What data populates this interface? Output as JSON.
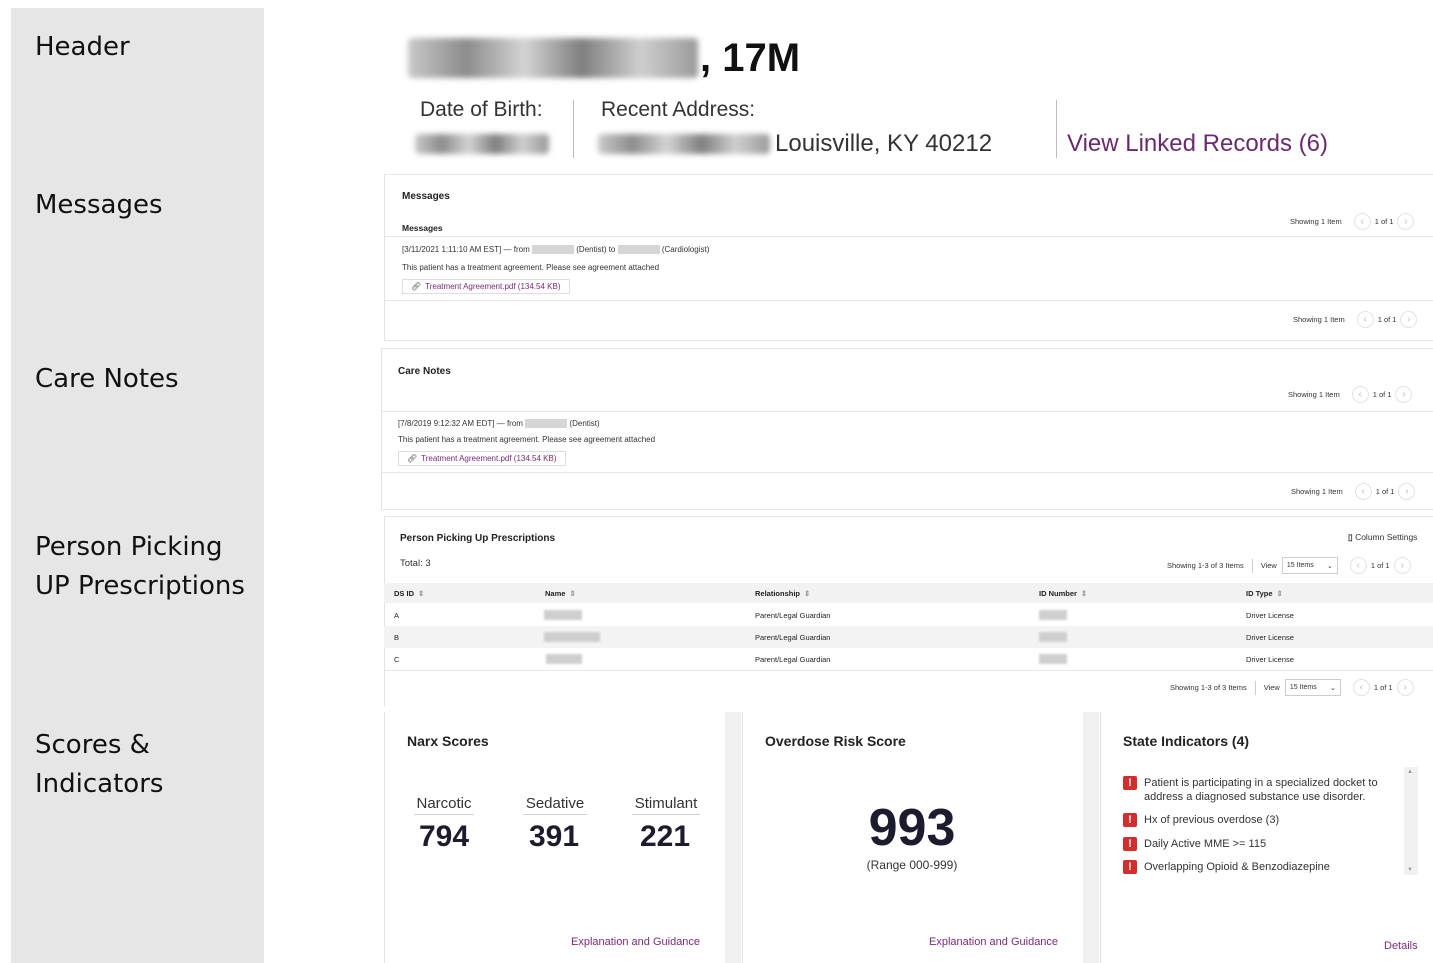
{
  "sidebar": {
    "labels": [
      "Header",
      "Messages",
      "Care Notes",
      "Person Picking\nUP Prescriptions",
      "Scores &\nIndicators"
    ]
  },
  "header": {
    "age_sex": ", 17M",
    "dob_label": "Date of Birth:",
    "address_label": "Recent Address:",
    "address_city": "Louisville, KY 40212",
    "linked_records": "View Linked Records (6)"
  },
  "messages": {
    "panel_title": "Messages",
    "section_title": "Messages",
    "pager_top": {
      "showing": "Showing 1 Item",
      "page": "1 of 1"
    },
    "pager_bottom": {
      "showing": "Showing 1 Item",
      "page": "1 of 1"
    },
    "meta_prefix": "[3/11/2021 1:11:10 AM EST] — from",
    "from_role": "(Dentist) to",
    "to_role": "(Cardiologist)",
    "body": "This patient has a treatment agreement. Please see agreement attached",
    "attachment": "Treatment Agreement.pdf (134.54 KB)"
  },
  "care_notes": {
    "title": "Care Notes",
    "pager_top": {
      "showing": "Showing 1 Item",
      "page": "1 of 1"
    },
    "pager_bottom": {
      "showing": "Showing 1 Item",
      "page": "1 of 1"
    },
    "meta_prefix": "[7/8/2019 9:12:32 AM EDT] — from",
    "from_role": "(Dentist)",
    "body": "This patient has a treatment agreement. Please see agreement attached",
    "attachment": "Treatment Agreement.pdf (134.54 KB)"
  },
  "pickup": {
    "title": "Person Picking Up Prescriptions",
    "column_settings": "Column Settings",
    "total": "Total: 3",
    "pager_top": {
      "showing": "Showing 1-3 of 3 Items",
      "view": "View",
      "per_page": "15 Items",
      "page": "1 of 1"
    },
    "pager_bottom": {
      "showing": "Showing 1-3 of 3 Items",
      "view": "View",
      "per_page": "15 Items",
      "page": "1 of 1"
    },
    "columns": [
      "DS ID",
      "Name",
      "Relationship",
      "ID Number",
      "ID Type"
    ],
    "rows": [
      {
        "ds_id": "A",
        "relationship": "Parent/Legal Guardian",
        "id_type": "Driver License"
      },
      {
        "ds_id": "B",
        "relationship": "Parent/Legal Guardian",
        "id_type": "Driver License"
      },
      {
        "ds_id": "C",
        "relationship": "Parent/Legal Guardian",
        "id_type": "Driver License"
      }
    ]
  },
  "narx": {
    "title": "Narx Scores",
    "scores": [
      {
        "label": "Narcotic",
        "value": "794"
      },
      {
        "label": "Sedative",
        "value": "391"
      },
      {
        "label": "Stimulant",
        "value": "221"
      }
    ],
    "link": "Explanation and Guidance"
  },
  "overdose": {
    "title": "Overdose Risk Score",
    "value": "993",
    "range": "(Range 000-999)",
    "link": "Explanation and Guidance"
  },
  "state_indicators": {
    "title": "State Indicators (4)",
    "items": [
      "Patient is participating in a specialized docket to address a diagnosed substance use disorder.",
      "Hx of previous overdose (3)",
      "Daily Active MME >= 115",
      "Overlapping Opioid & Benzodiazepine"
    ],
    "link": "Details"
  },
  "icons": {
    "prev": "chevron-left-icon",
    "next": "chevron-right-icon",
    "attachment": "paperclip-icon",
    "sort": "sort-icon",
    "alert": "alert-icon",
    "columns": "columns-icon"
  },
  "colors": {
    "link": "#6a2a6e",
    "alert": "#d22e2e",
    "score": "#1c1c2e"
  }
}
